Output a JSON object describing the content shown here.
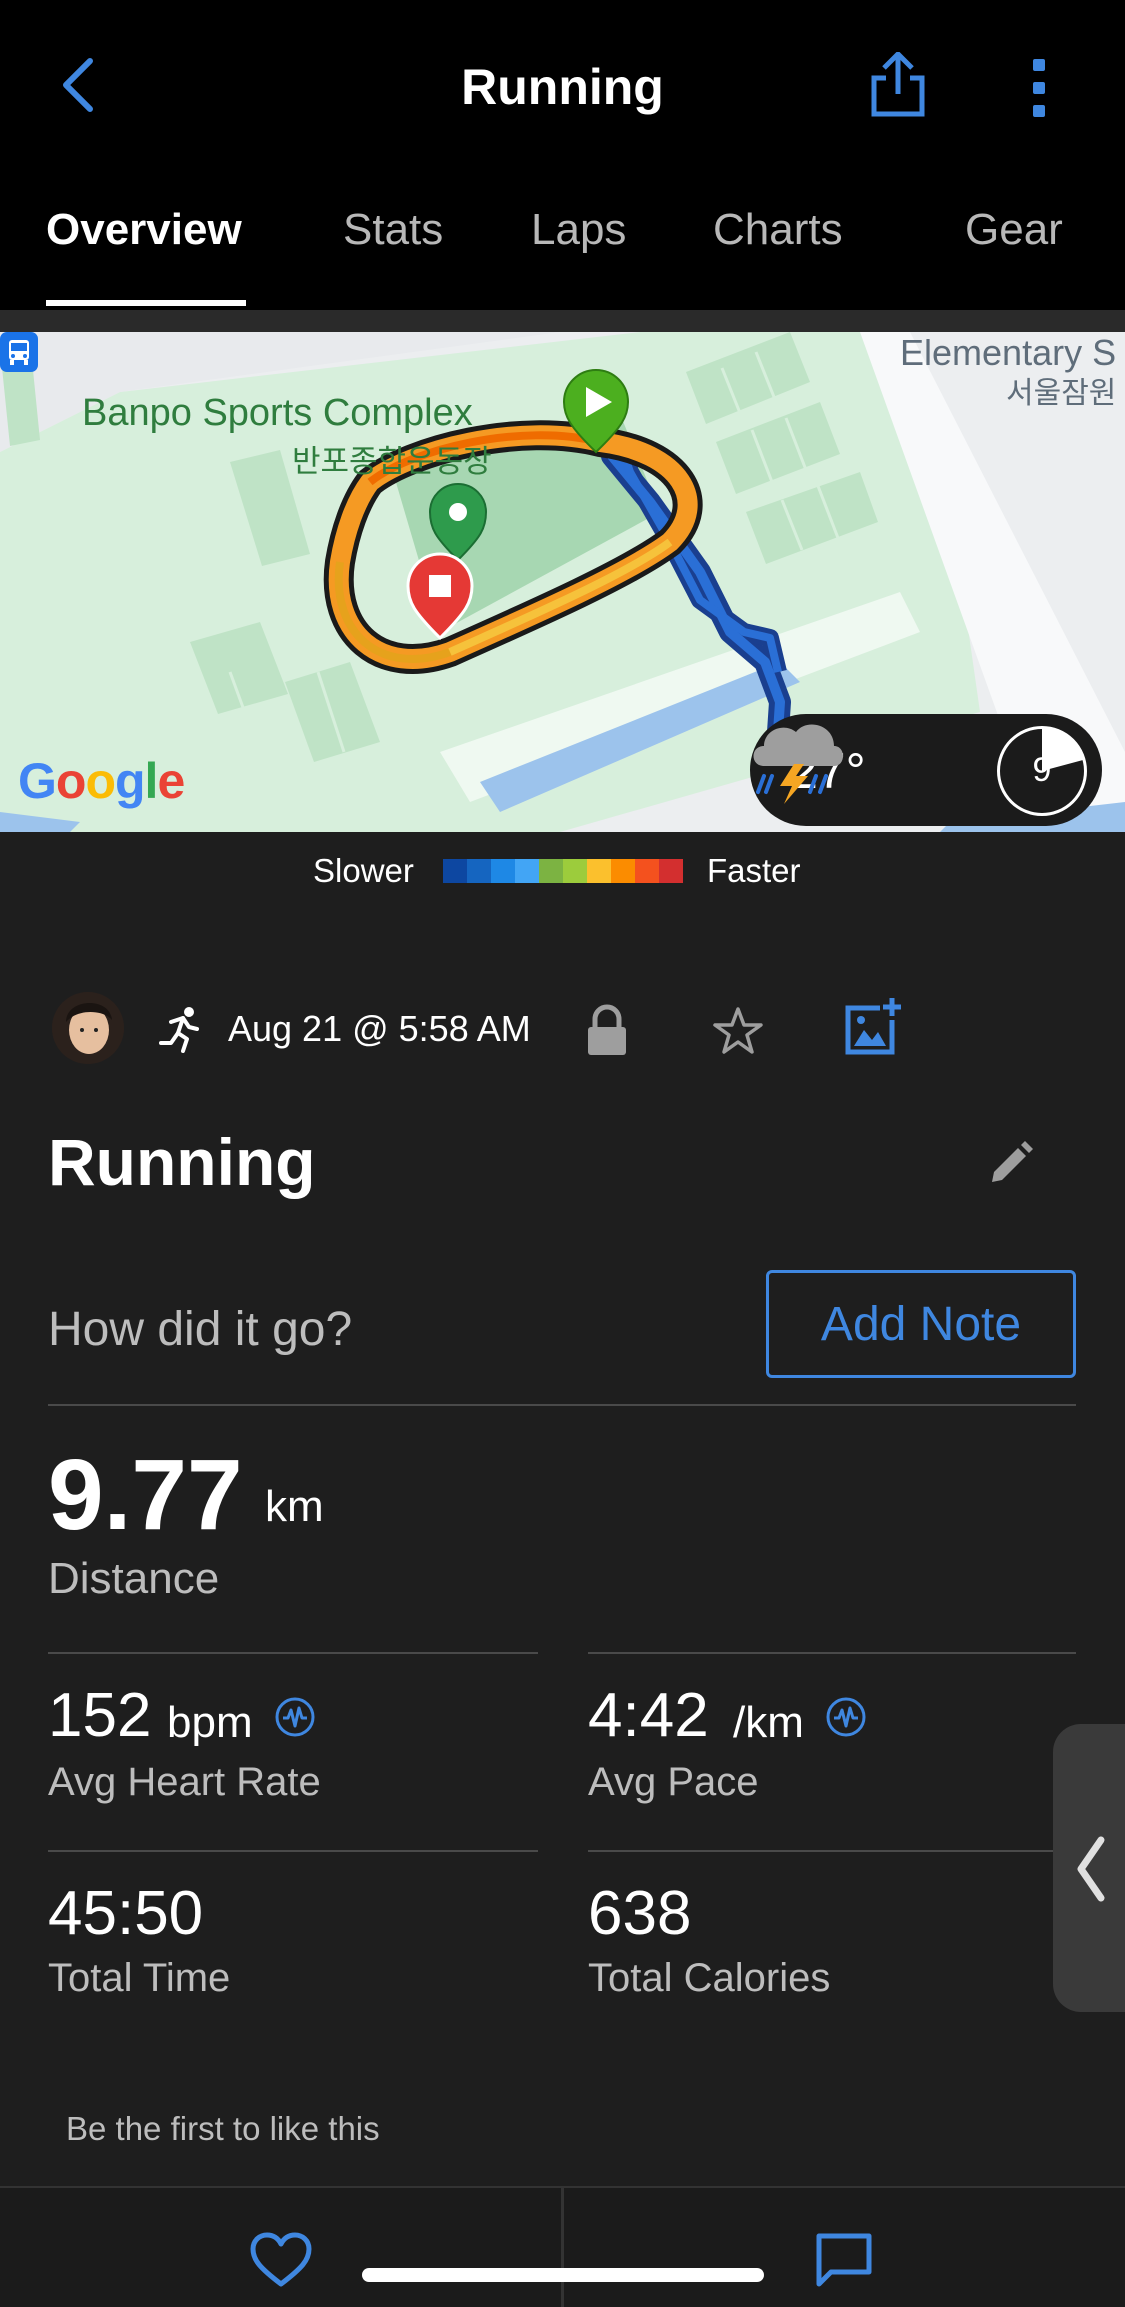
{
  "header": {
    "title": "Running"
  },
  "tabs": [
    {
      "label": "Overview",
      "active": true
    },
    {
      "label": "Stats"
    },
    {
      "label": "Laps"
    },
    {
      "label": "Charts"
    },
    {
      "label": "Gear"
    }
  ],
  "map": {
    "place_en": "Banpo Sports Complex",
    "place_ko": "반포종합운동장",
    "school_en": "Elementary S",
    "school_ko": "서울잠원",
    "google_logo": "Google",
    "weather": {
      "temp": "27°",
      "icon": "thunderstorm-icon",
      "wind": "9"
    }
  },
  "legend": {
    "slower": "Slower",
    "faster": "Faster",
    "colors": [
      "#0d47a1",
      "#1565c0",
      "#1e88e5",
      "#42a5f5",
      "#7cb342",
      "#9ccc3c",
      "#fbc02d",
      "#fb8c00",
      "#f4511e",
      "#d32f2f"
    ]
  },
  "meta": {
    "date": "Aug 21 @ 5:58 AM"
  },
  "activity": {
    "title": "Running"
  },
  "note": {
    "prompt": "How did it go?",
    "button": "Add Note"
  },
  "stats": {
    "distance": {
      "value": "9.77",
      "unit": "km",
      "label": "Distance"
    },
    "heart_rate": {
      "value": "152",
      "unit": "bpm",
      "label": "Avg Heart Rate"
    },
    "pace": {
      "value": "4:42",
      "unit": "/km",
      "label": "Avg Pace"
    },
    "time": {
      "value": "45:50",
      "label": "Total Time"
    },
    "calories": {
      "value": "638",
      "label": "Total Calories"
    }
  },
  "social": {
    "likes_text": "Be the first to like this"
  },
  "colors": {
    "accent": "#3f87e0",
    "background": "#1e1e1e"
  }
}
